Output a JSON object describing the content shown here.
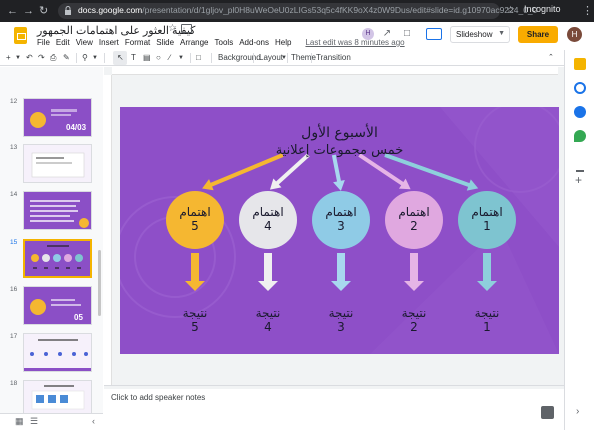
{
  "browser": {
    "url_host": "docs.google.com",
    "url_path": "/presentation/d/1gljov_pl0H8uWeOeU0zLIGs53q5c4fKK9oX4z0W9Dus/edit#slide=id.g10970ac9224_0_0",
    "incognito_label": "Incognito"
  },
  "app": {
    "doc_title": "كيفية العثور على اهتمامات الجمهور",
    "menu": [
      "File",
      "Edit",
      "View",
      "Insert",
      "Format",
      "Slide",
      "Arrange",
      "Tools",
      "Add-ons",
      "Help"
    ],
    "last_edit": "Last edit was 8 minutes ago",
    "slideshow_label": "Slideshow",
    "share_label": "Share",
    "collaborator_initial": "H",
    "user_initial": "H"
  },
  "toolbar": {
    "background": "Background",
    "layout": "Layout",
    "theme": "Theme",
    "transition": "Transition"
  },
  "filmstrip": {
    "numbers": [
      "12",
      "13",
      "14",
      "15",
      "16",
      "17",
      "18"
    ],
    "thumb_12_text": "04/03",
    "thumb_16_text": "05"
  },
  "slide": {
    "title": "الأسبوع الأول",
    "subtitle": "خمس مجموعات إعلانية",
    "interest_word": "اهتمام",
    "result_word": "نتيجة",
    "items": [
      {
        "num": "5",
        "color": "#f5b731",
        "arrow_color": "#f5b731"
      },
      {
        "num": "4",
        "color": "#e6e6ea",
        "arrow_color": "#f0f0f0"
      },
      {
        "num": "3",
        "color": "#8fcbe6",
        "arrow_color": "#a8d8ef"
      },
      {
        "num": "2",
        "color": "#e0a8e0",
        "arrow_color": "#e6b4e6"
      },
      {
        "num": "1",
        "color": "#7ec4d0",
        "arrow_color": "#8ed0dc"
      }
    ]
  },
  "notes": {
    "placeholder": "Click to add speaker notes"
  },
  "colors": {
    "slide_bg": "#8e4fc8",
    "accent_yellow": "#f4b400",
    "share_btn": "#f9ab00"
  }
}
